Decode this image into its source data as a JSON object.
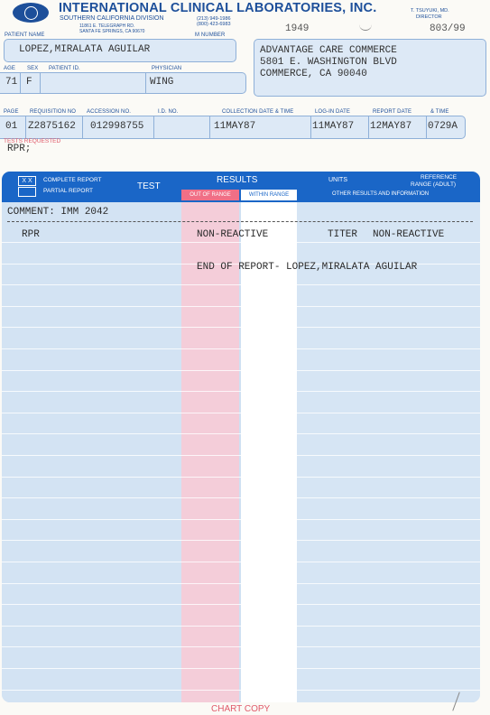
{
  "header": {
    "lab_name": "INTERNATIONAL CLINICAL LABORATORIES, INC.",
    "division": "SOUTHERN CALIFORNIA DIVISION",
    "address_line1": "11861 E. TELEGRAPH RD.",
    "address_line2": "SANTA FE SPRINGS, CA 90670",
    "phone1": "(213) 949-1986",
    "phone2": "(800) 423-6983",
    "director_name": "T. TSUYUKI, MD.",
    "director_title": "DIRECTOR",
    "page_counter": "803/99",
    "year_mark": "1949"
  },
  "labels": {
    "patient_name": "PATIENT NAME",
    "account_number": "M NUMBER",
    "age": "AGE",
    "sex": "SEX",
    "patient_id": "PATIENT ID.",
    "physician": "PHYSICIAN",
    "page": "PAGE",
    "requisition_no": "REQUISITION NO",
    "accession_no": "ACCESSION NO.",
    "id_no": "I.D. NO.",
    "collection": "COLLECTION DATE & TIME",
    "login_date": "LOG-IN DATE",
    "report_date": "REPORT DATE",
    "time": "& TIME",
    "tests_requested": "TESTS REQUESTED"
  },
  "patient": {
    "name": "LOPEZ,MIRALATA AGUILAR",
    "age": "71",
    "sex": "F",
    "physician": "WING"
  },
  "client": {
    "line1": "ADVANTAGE CARE COMMERCE",
    "line2": "5801 E. WASHINGTON BLVD",
    "line3": "COMMERCE, CA  90040"
  },
  "ids": {
    "page": "01",
    "requisition": "Z2875162",
    "accession": "012998755",
    "collection": "11MAY87",
    "login": "11MAY87",
    "report_date": "12MAY87",
    "report_time": "0729A"
  },
  "tests_requested_value": "RPR;",
  "table_header": {
    "xx": "X X",
    "complete": "COMPLETE REPORT",
    "partial": "PARTIAL REPORT",
    "test": "TEST",
    "results": "RESULTS",
    "out_of_range": "OUT OF RANGE",
    "within_range": "WITHIN RANGE",
    "units": "UNITS",
    "reference": "REFERENCE",
    "range_adult": "RANGE (ADULT)",
    "other": "OTHER RESULTS AND INFORMATION"
  },
  "report": {
    "comment": "COMMENT: IMM 2042",
    "test_name": "RPR",
    "result": "NON-REACTIVE",
    "units": "TITER",
    "reference": "NON-REACTIVE",
    "end_line": "END OF REPORT- LOPEZ,MIRALATA AGUILAR"
  },
  "footer": {
    "chart_copy": "CHART COPY"
  },
  "colors": {
    "brand_blue": "#1d4f9a",
    "out_of_range_pink": "#f4cdd9",
    "chart_copy_red": "#e05a6a"
  }
}
